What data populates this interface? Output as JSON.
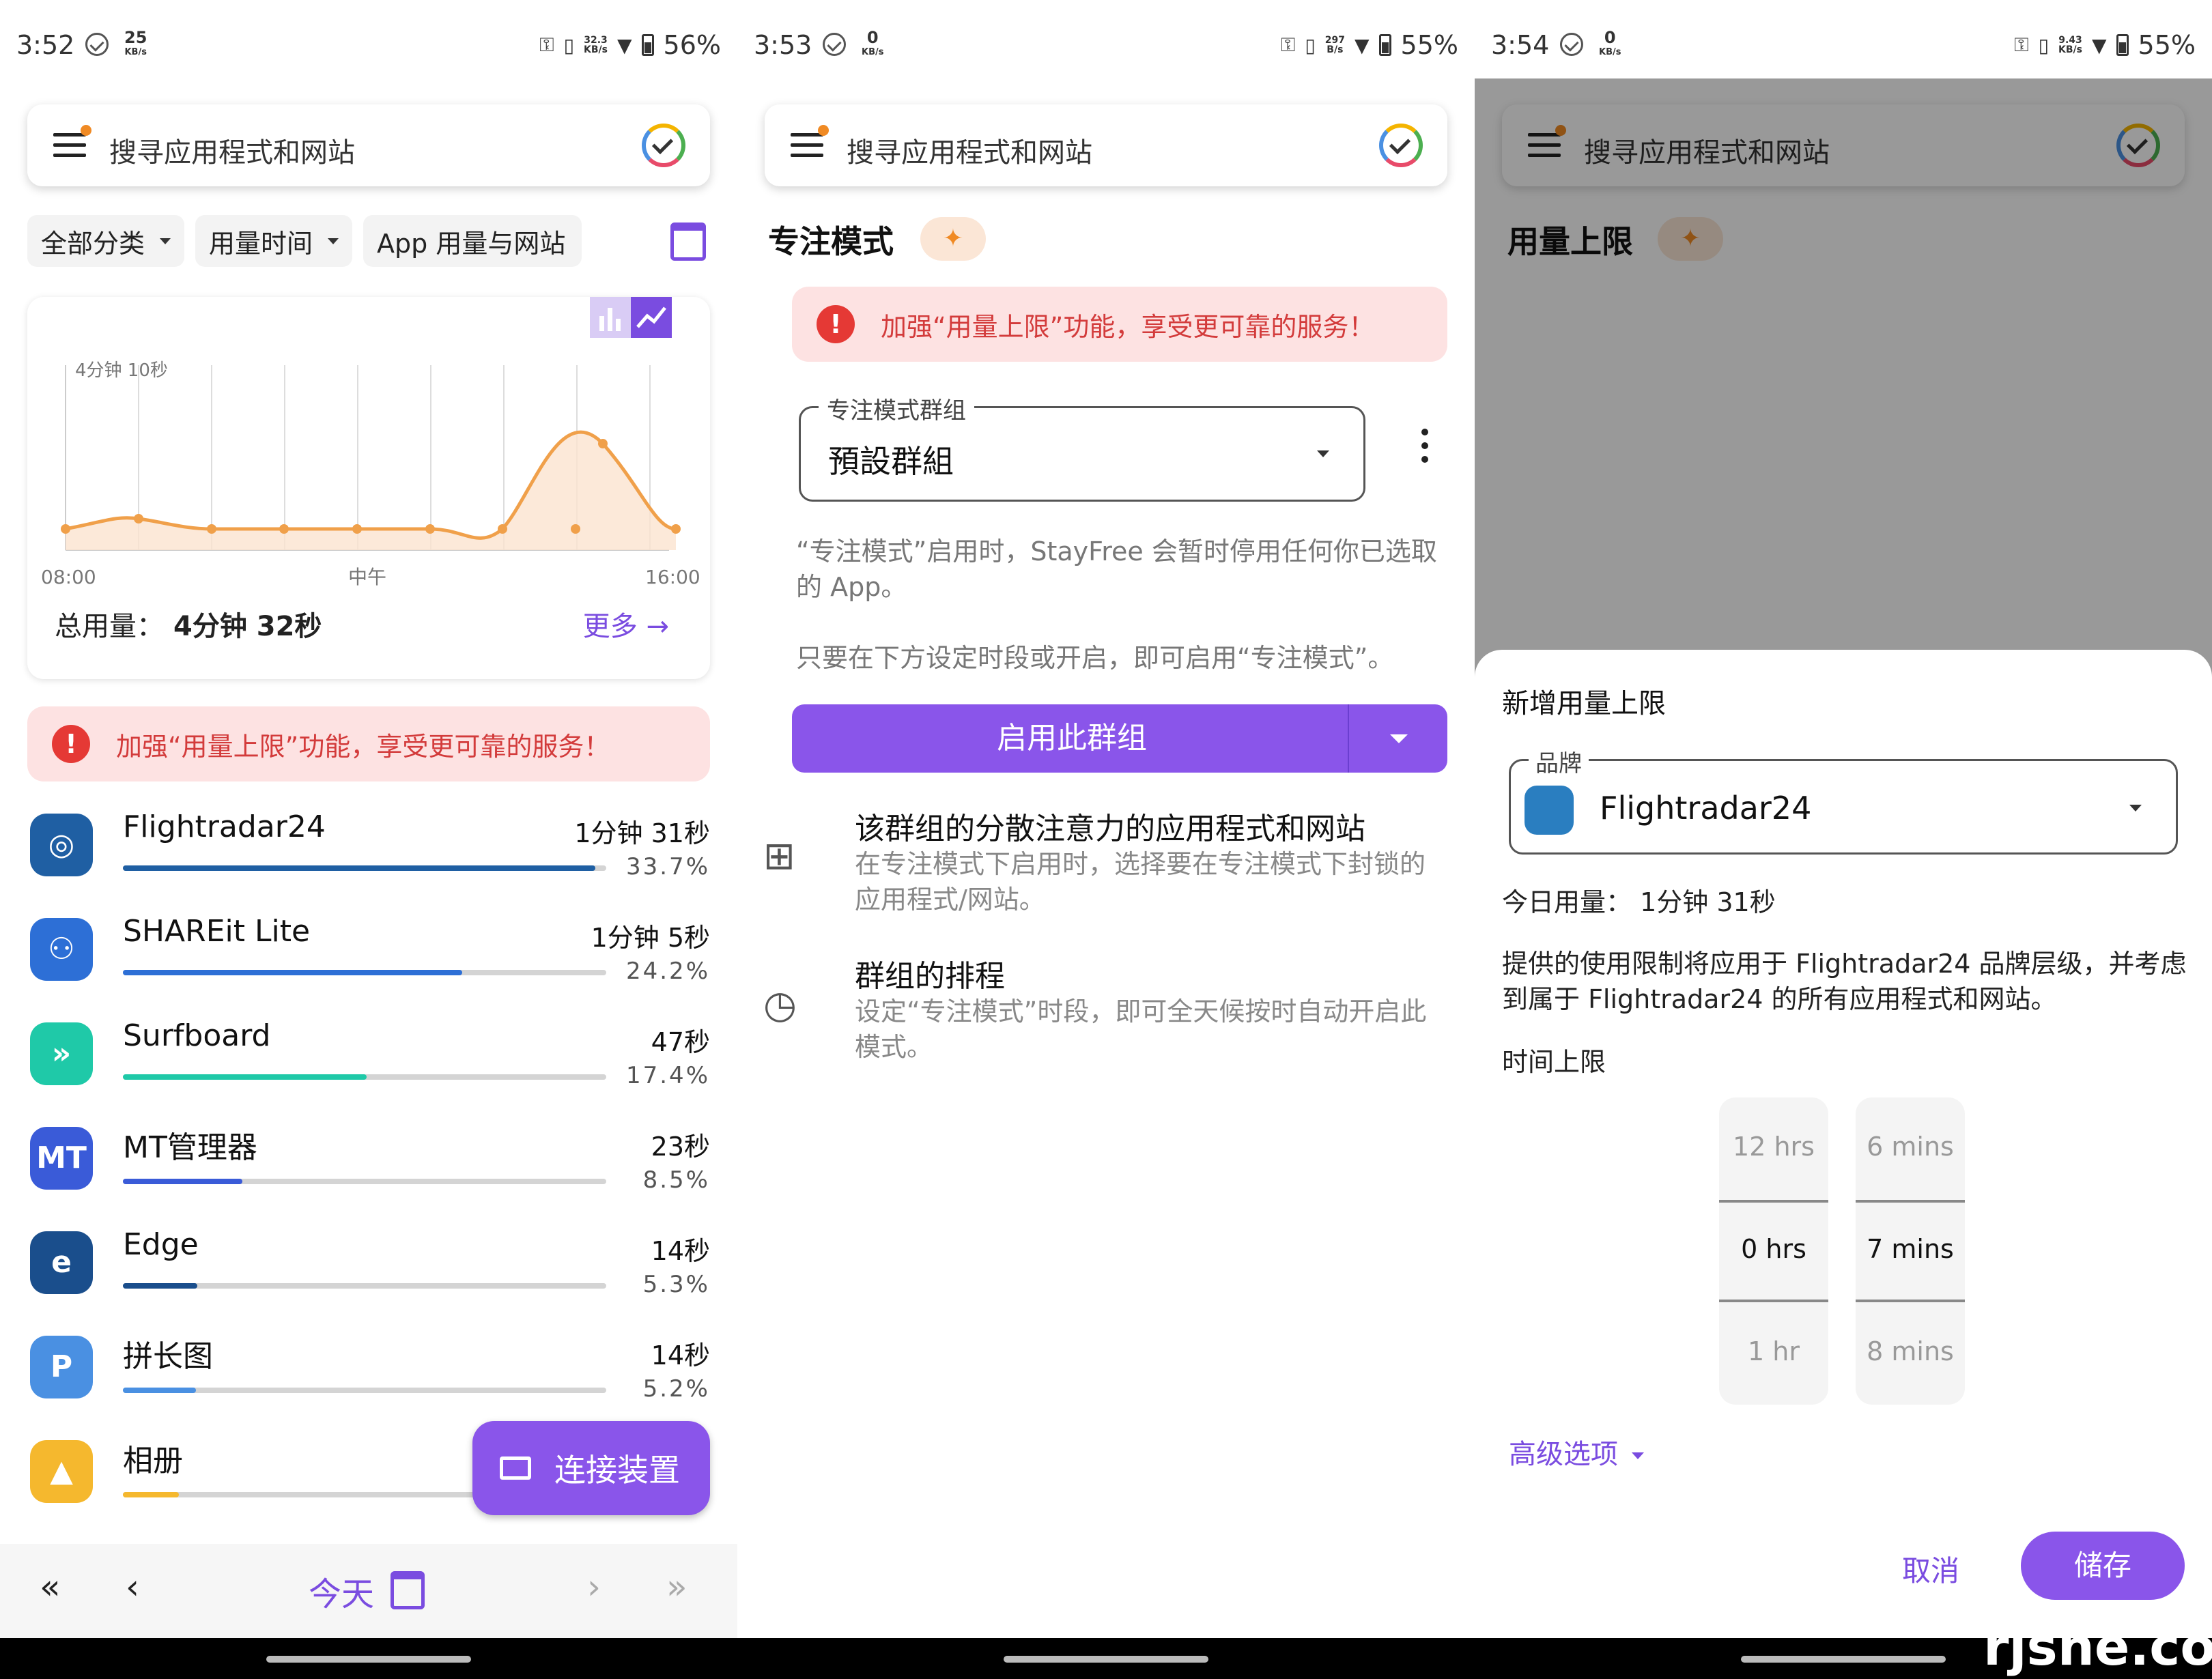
{
  "screens": [
    {
      "status": {
        "time": "3:52",
        "speed": "25",
        "speed_unit": "KB/s",
        "net": "32.3",
        "net_unit": "KB/s",
        "battery": "56%"
      },
      "search": {
        "placeholder": "搜寻应用程式和网站"
      },
      "filters": [
        {
          "label": "全部分类"
        },
        {
          "label": "用量时间"
        },
        {
          "label": "App 用量与网站"
        }
      ],
      "chart": {
        "ymax_label": "4分钟 10秒",
        "x_labels": [
          "08:00",
          "中午",
          "16:00"
        ]
      },
      "total": {
        "label": "总用量：",
        "value": "4分钟 32秒",
        "more": "更多 →"
      },
      "banner": "加强“用量上限”功能，享受更可靠的服务！",
      "apps": [
        {
          "name": "Flightradar24",
          "duration": "1分钟  31秒",
          "percent": "33.7%",
          "share": 33.7,
          "color": "#1f5fa3",
          "icon": "flightradar24-icon",
          "glyph": "◎"
        },
        {
          "name": "SHAREit Lite",
          "duration": "1分钟  5秒",
          "percent": "24.2%",
          "share": 24.2,
          "color": "#2d6fd6",
          "icon": "shareit-icon",
          "glyph": "⚇"
        },
        {
          "name": "Surfboard",
          "duration": "47秒",
          "percent": "17.4%",
          "share": 17.4,
          "color": "#1fc9a8",
          "icon": "surfboard-icon",
          "glyph": "»"
        },
        {
          "name": "MT管理器",
          "duration": "23秒",
          "percent": "8.5%",
          "share": 8.5,
          "color": "#3a5bd8",
          "icon": "mt-manager-icon",
          "glyph": "MT"
        },
        {
          "name": "Edge",
          "duration": "14秒",
          "percent": "5.3%",
          "share": 5.3,
          "color": "#1a4e8c",
          "icon": "edge-icon",
          "glyph": "e"
        },
        {
          "name": "拼长图",
          "duration": "14秒",
          "percent": "5.2%",
          "share": 5.2,
          "color": "#4a90e2",
          "icon": "pinchangtu-icon",
          "glyph": "P"
        },
        {
          "name": "相册",
          "duration": "",
          "percent": "",
          "share": 4.0,
          "color": "#f5b82e",
          "icon": "gallery-icon",
          "glyph": "▲"
        }
      ],
      "fab": "连接装置",
      "nav": {
        "today": "今天"
      }
    },
    {
      "status": {
        "time": "3:53",
        "speed": "0",
        "speed_unit": "KB/s",
        "net": "297",
        "net_unit": "B/s",
        "battery": "55%"
      },
      "search": {
        "placeholder": "搜寻应用程式和网站"
      },
      "title": "专注模式",
      "banner": "加强“用量上限”功能，享受更可靠的服务！",
      "group": {
        "label": "专注模式群组",
        "value": "預設群組"
      },
      "desc1": "“专注模式”启用时，StayFree 会暂时停用任何你已选取的 App。",
      "desc2": "只要在下方设定时段或开启，即可启用“专注模式”。",
      "enable_button": "启用此群组",
      "rows": [
        {
          "title": "该群组的分散注意力的应用程式和网站",
          "desc": "在专注模式下启用时，选择要在专注模式下封锁的应用程式/网站。"
        },
        {
          "title": "群组的排程",
          "desc": "设定“专注模式”时段，即可全天候按时自动开启此模式。"
        }
      ]
    },
    {
      "status": {
        "time": "3:54",
        "speed": "0",
        "speed_unit": "KB/s",
        "net": "9.43",
        "net_unit": "KB/s",
        "battery": "55%"
      },
      "search": {
        "placeholder": "搜寻应用程式和网站"
      },
      "title": "用量上限",
      "sheet": {
        "title": "新增用量上限",
        "brand_label": "品牌",
        "brand_value": "Flightradar24",
        "today_usage": "今日用量：  1分钟 31秒",
        "info": "提供的使用限制将应用于 Flightradar24 品牌层级，并考虑到属于 Flightradar24 的所有应用程式和网站。",
        "limit_label": "时间上限",
        "hours": [
          "12 hrs",
          "0 hrs",
          "1 hr"
        ],
        "mins": [
          "6 mins",
          "7 mins",
          "8 mins"
        ],
        "advanced": "高级选项",
        "cancel": "取消",
        "save": "储存"
      }
    }
  ],
  "watermark": "rjshe.com",
  "colors": {
    "accent": "#8a55ea",
    "warning_bg": "#fde2e2",
    "warning_text": "#d33b3b",
    "chart_line": "#f0a04a"
  }
}
